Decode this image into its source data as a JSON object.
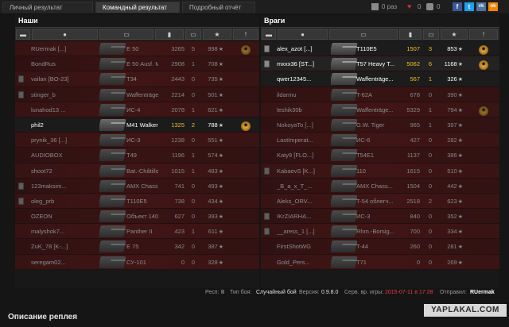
{
  "tabs": [
    {
      "label": "Личный результат",
      "active": false
    },
    {
      "label": "Командный результат",
      "active": true
    },
    {
      "label": "Подробный отчёт",
      "active": false
    }
  ],
  "top_stats": {
    "views": "0 раз",
    "likes": "0",
    "comments": "0"
  },
  "social": [
    "f",
    "t",
    "vk",
    "ok"
  ],
  "allies": {
    "title": "Наши",
    "rows": [
      {
        "name": "RUermak [...]",
        "vehicle": "E 50",
        "damage": "3265",
        "kills": "5",
        "xp": "998",
        "medal": true,
        "badge": false,
        "state": "dead"
      },
      {
        "name": "BondRus",
        "vehicle": "E 50 Ausf. M",
        "damage": "2908",
        "kills": "1",
        "xp": "708",
        "medal": false,
        "badge": false,
        "state": "dead"
      },
      {
        "name": "vailan [BO-23]",
        "vehicle": "T34",
        "damage": "2443",
        "kills": "0",
        "xp": "735",
        "medal": false,
        "badge": true,
        "state": "dead"
      },
      {
        "name": "stinger_b",
        "vehicle": "Waffenträge...",
        "damage": "2214",
        "kills": "0",
        "xp": "501",
        "medal": false,
        "badge": true,
        "state": "dead"
      },
      {
        "name": "lunahod13 ...",
        "vehicle": "ИС-4",
        "damage": "2078",
        "kills": "1",
        "xp": "621",
        "medal": false,
        "badge": false,
        "state": "dead"
      },
      {
        "name": "phil2",
        "vehicle": "M41 Walker ...",
        "damage": "1325",
        "kills": "2",
        "xp": "788",
        "medal": true,
        "badge": false,
        "state": "me"
      },
      {
        "name": "prynik_36 [...]",
        "vehicle": "ИС-3",
        "damage": "1238",
        "kills": "0",
        "xp": "551",
        "medal": false,
        "badge": false,
        "state": "dead"
      },
      {
        "name": "AUDIOBOX",
        "vehicle": "T49",
        "damage": "1196",
        "kills": "1",
        "xp": "574",
        "medal": false,
        "badge": false,
        "state": "dead"
      },
      {
        "name": "shoot72",
        "vehicle": "Bat.-Châtillo...",
        "damage": "1015",
        "kills": "1",
        "xp": "483",
        "medal": false,
        "badge": false,
        "state": "dead"
      },
      {
        "name": "123maksim...",
        "vehicle": "AMX Chass...",
        "damage": "741",
        "kills": "0",
        "xp": "493",
        "medal": false,
        "badge": true,
        "state": "dead"
      },
      {
        "name": "oleg_prb",
        "vehicle": "T110E5",
        "damage": "738",
        "kills": "0",
        "xp": "434",
        "medal": false,
        "badge": true,
        "state": "dead"
      },
      {
        "name": "OZEON",
        "vehicle": "Объект 140",
        "damage": "627",
        "kills": "0",
        "xp": "393",
        "medal": false,
        "badge": false,
        "state": "dead"
      },
      {
        "name": "malyshok7...",
        "vehicle": "Panther II",
        "damage": "423",
        "kills": "1",
        "xp": "611",
        "medal": false,
        "badge": false,
        "state": "dead"
      },
      {
        "name": "ZuK_78 [K-...]",
        "vehicle": "E 75",
        "damage": "342",
        "kills": "0",
        "xp": "387",
        "medal": false,
        "badge": false,
        "state": "dead"
      },
      {
        "name": "seregam02...",
        "vehicle": "СУ-101",
        "damage": "0",
        "kills": "0",
        "xp": "328",
        "medal": false,
        "badge": false,
        "state": "dead"
      }
    ]
  },
  "enemies": {
    "title": "Враги",
    "rows": [
      {
        "name": "alex_azot [...]",
        "vehicle": "T110E5",
        "damage": "1507",
        "kills": "3",
        "xp": "853",
        "medal": true,
        "badge": true,
        "state": "alive",
        "highlight": true
      },
      {
        "name": "mxxx36 [ST...]",
        "vehicle": "T57 Heavy T...",
        "damage": "5062",
        "kills": "6",
        "xp": "1168",
        "medal": true,
        "badge": true,
        "state": "alive",
        "highlight": true
      },
      {
        "name": "qwer12345...",
        "vehicle": "Waffenträge...",
        "damage": "567",
        "kills": "1",
        "xp": "326",
        "medal": false,
        "badge": false,
        "state": "alive",
        "highlight": true
      },
      {
        "name": "ildarmu",
        "vehicle": "T-62A",
        "damage": "678",
        "kills": "0",
        "xp": "390",
        "medal": false,
        "badge": false,
        "state": "dead"
      },
      {
        "name": "leshik30b",
        "vehicle": "Waffenträge...",
        "damage": "5329",
        "kills": "1",
        "xp": "794",
        "medal": true,
        "badge": false,
        "state": "dead"
      },
      {
        "name": "NokoyaTo [...]",
        "vehicle": "G.W. Tiger",
        "damage": "965",
        "kills": "1",
        "xp": "397",
        "medal": false,
        "badge": false,
        "state": "dead"
      },
      {
        "name": "LastImperat...",
        "vehicle": "ИС-6",
        "damage": "427",
        "kills": "0",
        "xp": "282",
        "medal": false,
        "badge": false,
        "state": "dead"
      },
      {
        "name": "Katy9 [FLO...]",
        "vehicle": "T54E1",
        "damage": "1137",
        "kills": "0",
        "xp": "386",
        "medal": false,
        "badge": false,
        "state": "dead"
      },
      {
        "name": "KabaevS [K...]",
        "vehicle": "110",
        "damage": "1615",
        "kills": "0",
        "xp": "510",
        "medal": false,
        "badge": true,
        "state": "dead"
      },
      {
        "name": "_B_a_x_T_...",
        "vehicle": "AMX Chass...",
        "damage": "1504",
        "kills": "0",
        "xp": "442",
        "medal": false,
        "badge": false,
        "state": "dead"
      },
      {
        "name": "Aleks_ORV...",
        "vehicle": "T-54 облегч...",
        "damage": "2518",
        "kills": "2",
        "xp": "623",
        "medal": false,
        "badge": false,
        "state": "dead"
      },
      {
        "name": "IKrZIARHA...",
        "vehicle": "ИС-3",
        "damage": "840",
        "kills": "0",
        "xp": "352",
        "medal": false,
        "badge": true,
        "state": "dead"
      },
      {
        "name": "__aress_1 [...]",
        "vehicle": "Rhm.-Borsig...",
        "damage": "700",
        "kills": "0",
        "xp": "334",
        "medal": false,
        "badge": true,
        "state": "dead"
      },
      {
        "name": "FirstShotWG",
        "vehicle": "T-44",
        "damage": "260",
        "kills": "0",
        "xp": "281",
        "medal": false,
        "badge": false,
        "state": "dead"
      },
      {
        "name": "Gold_Pers...",
        "vehicle": "T71",
        "damage": "0",
        "kills": "0",
        "xp": "269",
        "medal": false,
        "badge": false,
        "state": "dead"
      }
    ]
  },
  "footer": {
    "resp_label": "Респ:",
    "resp_value": "II",
    "type_label": "Тип боя:",
    "type_value": "Случайный бой",
    "version_label": "Версия:",
    "version_value": "0.9.8.0",
    "serv_label": "Серв. вр. игры:",
    "serv_value": "2015-07-11 в 17:28",
    "sender_label": "Отправил:",
    "sender_value": "RUermak"
  },
  "section_title": "Описание реплея",
  "watermark": "YAPLAKAL.COM",
  "colors": {
    "row_red": "#541313",
    "gold": "#f0c020",
    "bg": "#151515"
  }
}
